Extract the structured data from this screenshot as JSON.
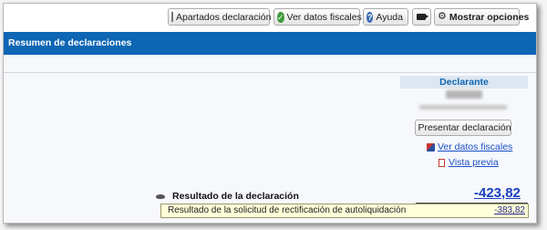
{
  "toolbar": {
    "apartados_label": "Apartados declaración",
    "apartados_icon": "document-icon",
    "fiscales_label": "Ver datos fiscales",
    "fiscales_icon": "check-icon",
    "ayuda_label": "Ayuda",
    "ayuda_icon": "help-icon",
    "video_icon": "video-camera-icon",
    "opciones_label": "Mostrar opciones",
    "opciones_icon": "gear-icon"
  },
  "header": {
    "title": "Resumen de declaraciones",
    "color": "#0e66b4"
  },
  "declarante": {
    "heading": "Declarante",
    "present_button": "Presentar declaración",
    "present_icon": "flag-icon",
    "link_fiscales": "Ver datos fiscales",
    "link_fiscales_icon": "flag-icon",
    "link_vista": "Vista previa",
    "link_vista_icon": "pdf-icon"
  },
  "resultado": {
    "label": "Resultado de la declaración",
    "icon": "eye-icon",
    "value": "-423,82",
    "value_color": "#1a3fbf"
  },
  "tooltip": {
    "text": "Resultado de la solicitud de rectificación de autoliquidación",
    "value": "-383,82"
  }
}
